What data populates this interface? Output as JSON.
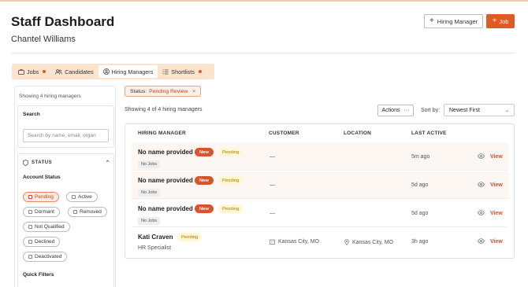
{
  "header": {
    "title": "Staff Dashboard",
    "user_name": "Chantel Williams",
    "hiring_manager_button": "Hiring Manager",
    "job_button": "Job"
  },
  "tabs": [
    {
      "label": "Jobs",
      "icon": "briefcase-icon",
      "dot": true
    },
    {
      "label": "Candidates",
      "icon": "users-icon",
      "dot": false
    },
    {
      "label": "Hiring Managers",
      "icon": "user-circle-icon",
      "dot": false,
      "active": true
    },
    {
      "label": "Shortlists",
      "icon": "list-icon",
      "dot": true
    }
  ],
  "sidebar": {
    "showing": "Showing 4 hiring managers",
    "search_label": "Search",
    "search_placeholder": "Search by name, email, organ",
    "status_heading": "STATUS",
    "account_status_label": "Account Status",
    "chips": [
      "Pending",
      "Active",
      "Dormant",
      "Removed",
      "Not Qualified",
      "Declined",
      "Deactivated"
    ],
    "selected_chip": "Pending",
    "quick_filters_label": "Quick Filters"
  },
  "filter": {
    "label": "Status:",
    "value": "Pending Review",
    "remove": "×"
  },
  "toolbar": {
    "showing": "Showing 4 of 4 hiring managers",
    "actions_label": "Actions",
    "sort_label": "Sort by:",
    "sort_value": "Newest First"
  },
  "table": {
    "columns": [
      "HIRING MANAGER",
      "CUSTOMER",
      "LOCATION",
      "LAST ACTIVE"
    ],
    "rows": [
      {
        "name": "No name provided",
        "new_badge": "New",
        "status": "Pending",
        "sub_badge": "No Jobs",
        "customer": "—",
        "location": "",
        "last_active": "5m ago",
        "view": "View"
      },
      {
        "name": "No name provided",
        "new_badge": "New",
        "status": "Pending",
        "sub_badge": "No Jobs",
        "customer": "—",
        "location": "",
        "last_active": "5d ago",
        "view": "View"
      },
      {
        "name": "No name provided",
        "new_badge": "New",
        "status": "Pending",
        "sub_badge": "No Jobs",
        "customer": "—",
        "location": "",
        "last_active": "5d ago",
        "view": "View"
      },
      {
        "name": "Kati Craven",
        "status": "Pending",
        "subtitle": "HR Specialist",
        "customer": "Kansas City, MO",
        "location": "Kansas City, MO",
        "last_active": "3h ago",
        "view": "View"
      }
    ]
  },
  "colors": {
    "accent": "#e05a24",
    "tab_bar_bg": "#fbe3cd",
    "pending_bg": "#fff6d6"
  }
}
